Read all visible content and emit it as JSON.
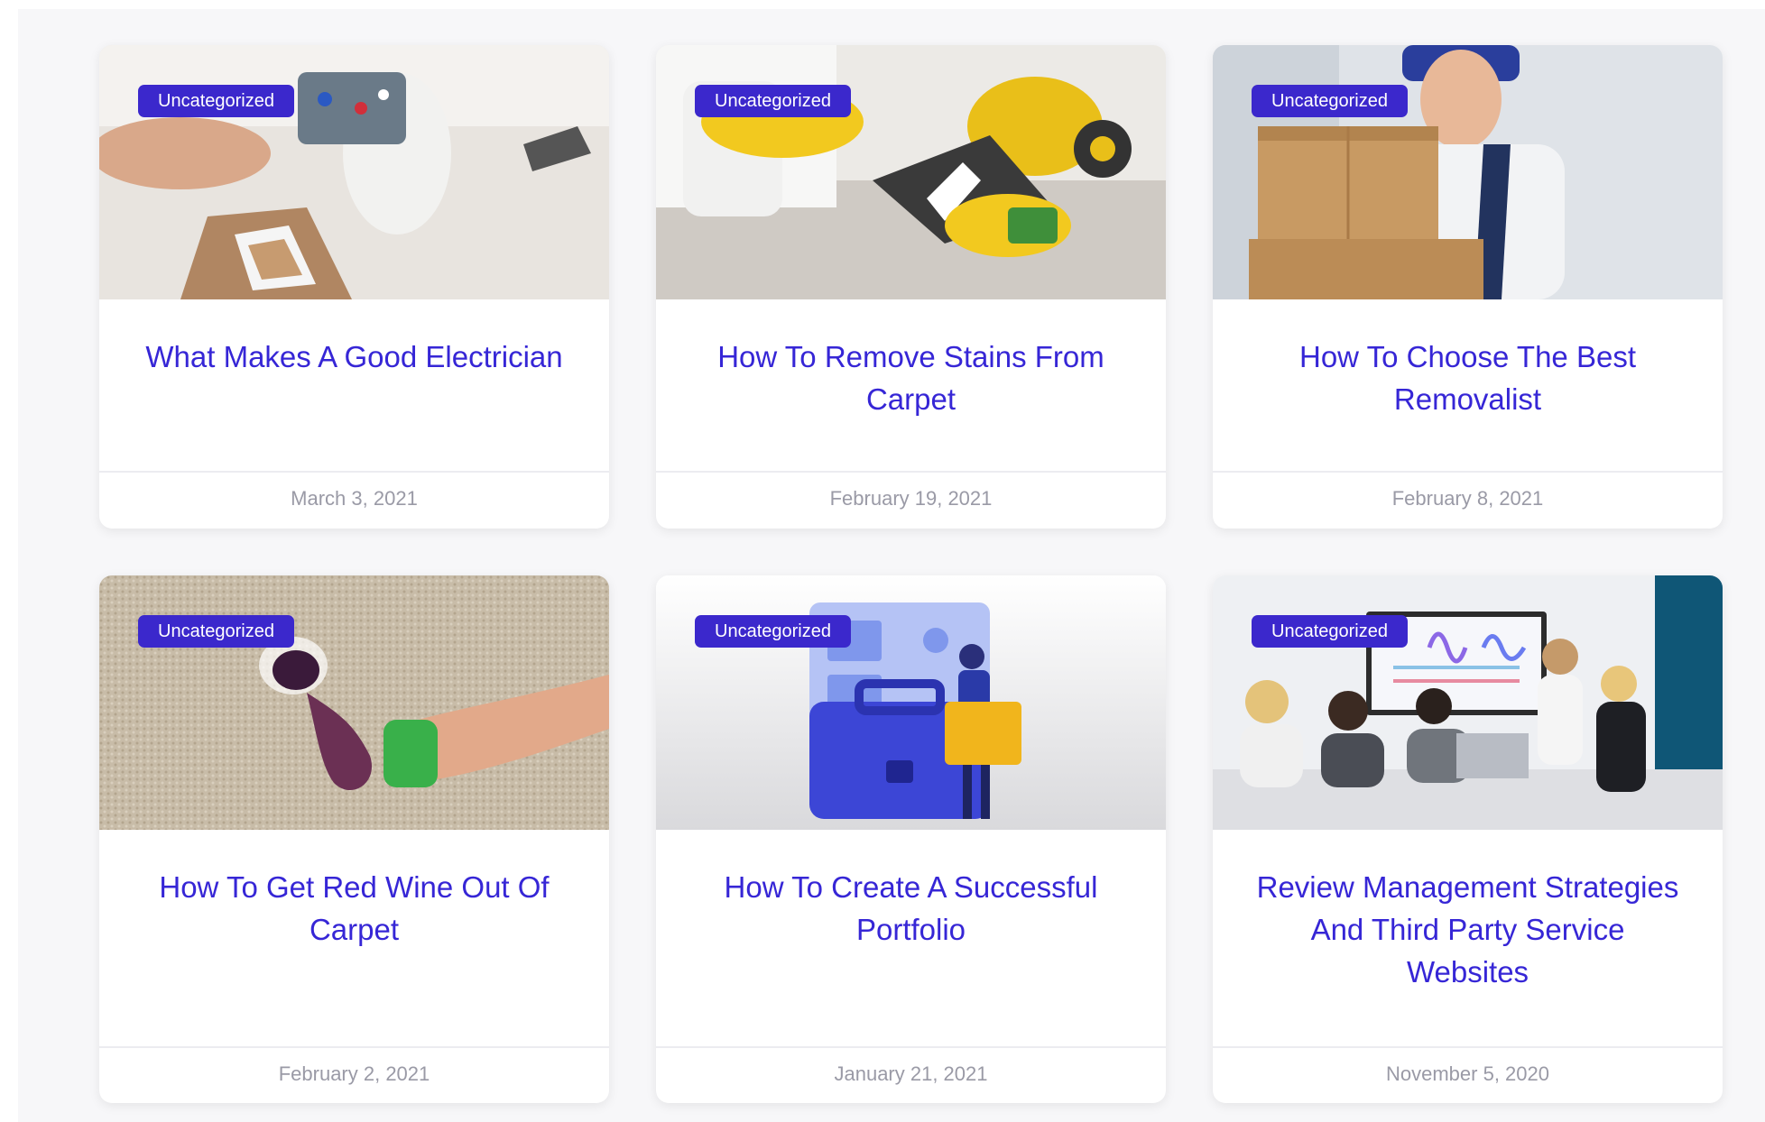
{
  "posts": [
    {
      "category": "Uncategorized",
      "title": "What Makes A Good Electrician",
      "date": "March 3, 2021",
      "image": "electrician-photo"
    },
    {
      "category": "Uncategorized",
      "title": "How To Remove Stains From Carpet",
      "date": "February 19, 2021",
      "image": "carpet-cleaning-photo"
    },
    {
      "category": "Uncategorized",
      "title": "How To Choose The Best Removalist",
      "date": "February 8, 2021",
      "image": "mover-with-boxes-photo"
    },
    {
      "category": "Uncategorized",
      "title": "How To Get Red Wine Out Of Carpet",
      "date": "February 2, 2021",
      "image": "wine-stain-photo"
    },
    {
      "category": "Uncategorized",
      "title": "How To Create A Successful Portfolio",
      "date": "January 21, 2021",
      "image": "portfolio-illustration"
    },
    {
      "category": "Uncategorized",
      "title": "Review Management Strategies And Third Party Service Websites",
      "date": "November 5, 2020",
      "image": "meeting-room-photo"
    }
  ],
  "colors": {
    "accent": "#3626d6",
    "badge": "#3b28cc",
    "date": "#9a9aa6"
  }
}
